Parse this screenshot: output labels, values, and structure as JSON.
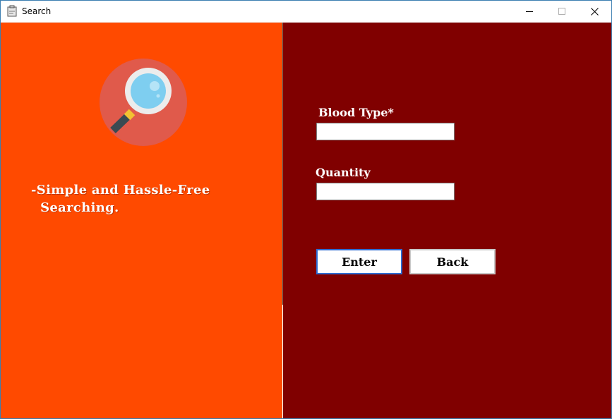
{
  "window": {
    "title": "Search"
  },
  "left_panel": {
    "tagline": "-Simple and Hassle-Free\n  Searching.",
    "background": "#ff4a00",
    "logo_icon": "magnifying-glass-icon"
  },
  "form": {
    "blood_type_label": "Blood Type*",
    "blood_type_value": "",
    "quantity_label": "Quantity",
    "quantity_value": "",
    "enter_label": "Enter",
    "back_label": "Back",
    "background": "#800000"
  },
  "colors": {
    "accent_focus": "#2e6bd0",
    "logo_circle": "#e05a4b",
    "lens": "#7ecef0"
  }
}
